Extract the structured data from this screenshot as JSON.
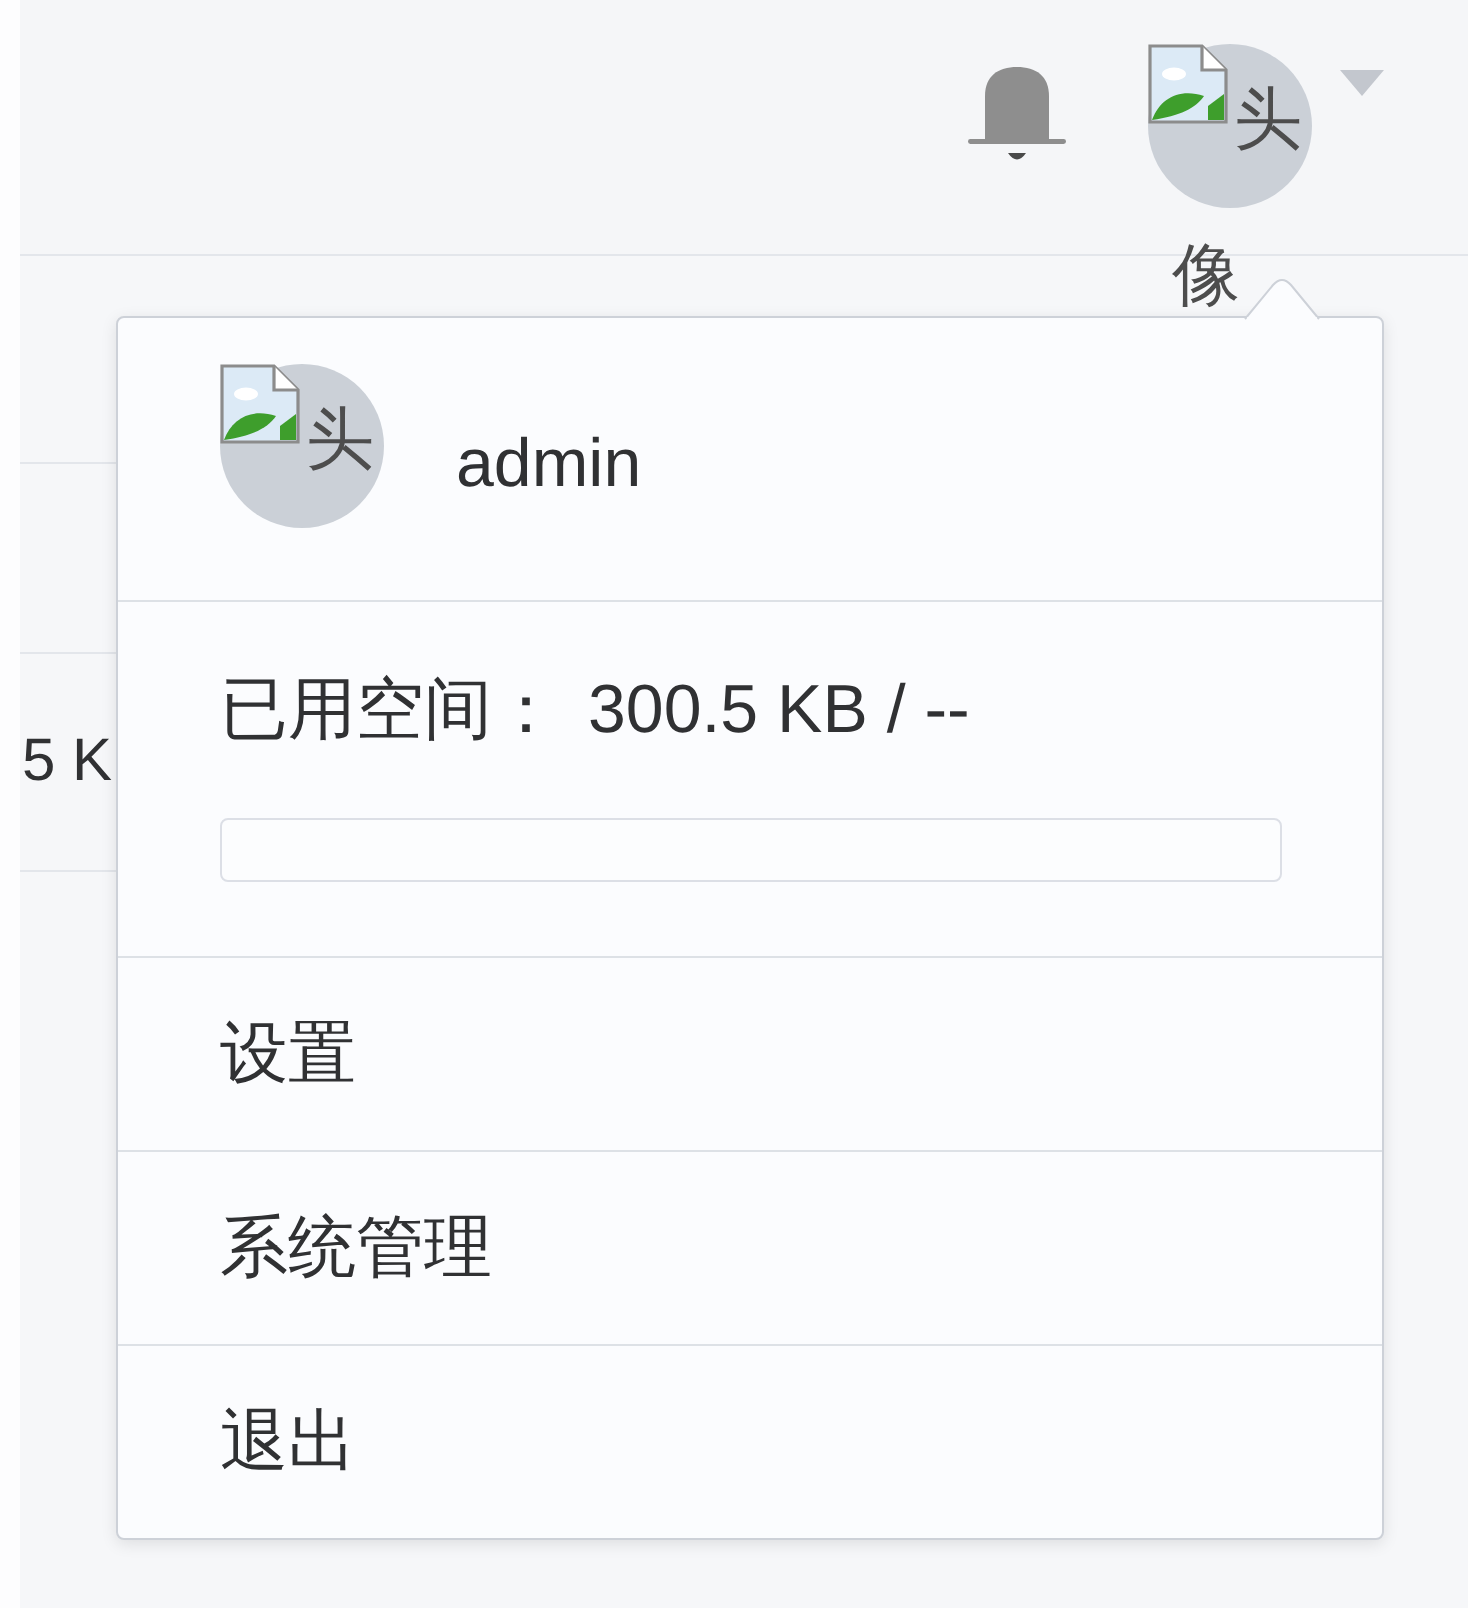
{
  "header": {
    "avatar": {
      "alt_text": [
        "头",
        "像"
      ]
    }
  },
  "table": {
    "rows": [
      {
        "column_1": "5 K"
      }
    ]
  },
  "user_menu": {
    "avatar": {
      "alt_text": [
        "头"
      ]
    },
    "username": "admin",
    "storage": {
      "label": "已用空间：",
      "value": "300.5 KB / --"
    },
    "items": [
      {
        "label": "设置"
      },
      {
        "label": "系统管理"
      },
      {
        "label": "退出"
      }
    ]
  }
}
